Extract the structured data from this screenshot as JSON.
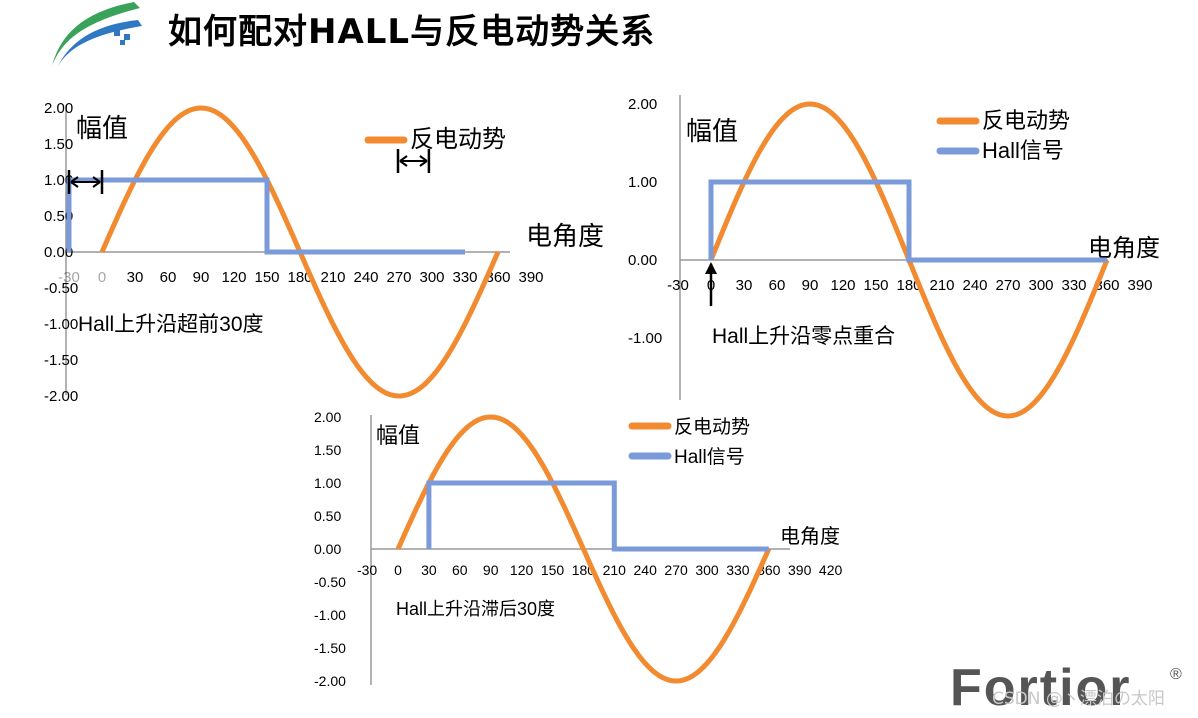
{
  "title": "如何配对HALL与反电动势关系",
  "brand": "Fortior",
  "brand_mark": "®",
  "watermark": "CSDN @丶漂泊の太阳",
  "colors": {
    "bemf": "#f28a30",
    "hall": "#7b9ad9",
    "axis": "#999999",
    "text": "#000000"
  },
  "chart_data": [
    {
      "type": "line",
      "ylabel": "幅值",
      "xlabel": "电角度",
      "annotation": "Hall上升沿超前30度",
      "yticks": [
        "2.00",
        "1.50",
        "1.00",
        "0.50",
        "0.00",
        "-0.50",
        "-1.00",
        "-1.50",
        "-2.00"
      ],
      "xticks": [
        "-30",
        "0",
        "30",
        "60",
        "90",
        "120",
        "150",
        "180",
        "210",
        "240",
        "270",
        "300",
        "330",
        "360",
        "390"
      ],
      "ylim": [
        -2,
        2
      ],
      "xlim": [
        -30,
        390
      ],
      "legend": [
        "反电动势"
      ],
      "series": [
        {
          "name": "反电动势",
          "kind": "sine",
          "amplitude": 2,
          "phase_deg": 0,
          "x_start": 0,
          "x_end": 360
        },
        {
          "kind": "step",
          "points": [
            [
              -30,
              0
            ],
            [
              -30,
              1
            ],
            [
              150,
              1
            ],
            [
              150,
              0
            ],
            [
              330,
              0
            ]
          ]
        }
      ]
    },
    {
      "type": "line",
      "ylabel": "幅值",
      "xlabel": "电角度",
      "annotation": "Hall上升沿零点重合",
      "yticks": [
        "2.00",
        "1.00",
        "0.00",
        "-1.00"
      ],
      "xticks": [
        "-30",
        "0",
        "30",
        "60",
        "90",
        "120",
        "150",
        "180",
        "210",
        "240",
        "270",
        "300",
        "330",
        "360",
        "390"
      ],
      "ylim": [
        -2,
        2
      ],
      "xlim": [
        -30,
        390
      ],
      "legend": [
        "反电动势",
        "Hall信号"
      ],
      "series": [
        {
          "name": "反电动势",
          "kind": "sine",
          "amplitude": 2,
          "phase_deg": 0,
          "x_start": 0,
          "x_end": 360
        },
        {
          "name": "Hall信号",
          "kind": "step",
          "points": [
            [
              0,
              0
            ],
            [
              0,
              1
            ],
            [
              180,
              1
            ],
            [
              180,
              0
            ],
            [
              360,
              0
            ]
          ]
        }
      ]
    },
    {
      "type": "line",
      "ylabel": "幅值",
      "xlabel": "电角度",
      "annotation": "Hall上升沿滞后30度",
      "yticks": [
        "2.00",
        "1.50",
        "1.00",
        "0.50",
        "0.00",
        "-0.50",
        "-1.00",
        "-1.50",
        "-2.00"
      ],
      "xticks": [
        "-30",
        "0",
        "30",
        "60",
        "90",
        "120",
        "150",
        "180",
        "210",
        "240",
        "270",
        "300",
        "330",
        "360",
        "390",
        "420"
      ],
      "ylim": [
        -2,
        2
      ],
      "xlim": [
        -30,
        420
      ],
      "legend": [
        "反电动势",
        "Hall信号"
      ],
      "series": [
        {
          "name": "反电动势",
          "kind": "sine",
          "amplitude": 2,
          "phase_deg": 0,
          "x_start": 0,
          "x_end": 360
        },
        {
          "name": "Hall信号",
          "kind": "step",
          "points": [
            [
              30,
              0
            ],
            [
              30,
              1
            ],
            [
              210,
              1
            ],
            [
              210,
              0
            ],
            [
              360,
              0
            ]
          ]
        }
      ]
    }
  ]
}
